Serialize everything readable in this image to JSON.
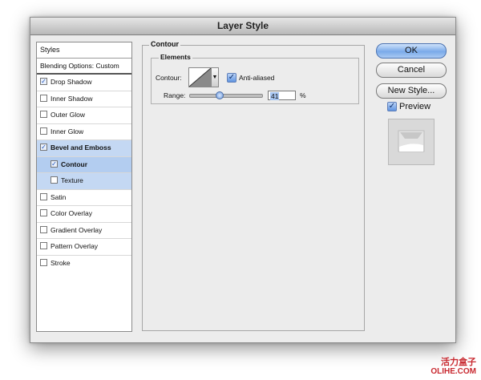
{
  "window": {
    "title": "Layer Style"
  },
  "styles_panel": {
    "header": "Styles",
    "blending_options": "Blending Options: Custom",
    "items": [
      {
        "label": "Drop Shadow",
        "checked": true,
        "bold": false,
        "indent": false
      },
      {
        "label": "Inner Shadow",
        "checked": false,
        "bold": false,
        "indent": false
      },
      {
        "label": "Outer Glow",
        "checked": false,
        "bold": false,
        "indent": false
      },
      {
        "label": "Inner Glow",
        "checked": false,
        "bold": false,
        "indent": false
      },
      {
        "label": "Bevel and Emboss",
        "checked": true,
        "bold": true,
        "indent": false
      },
      {
        "label": "Contour",
        "checked": true,
        "bold": true,
        "indent": true
      },
      {
        "label": "Texture",
        "checked": false,
        "bold": false,
        "indent": true
      },
      {
        "label": "Satin",
        "checked": false,
        "bold": false,
        "indent": false
      },
      {
        "label": "Color Overlay",
        "checked": false,
        "bold": false,
        "indent": false
      },
      {
        "label": "Gradient Overlay",
        "checked": false,
        "bold": false,
        "indent": false
      },
      {
        "label": "Pattern Overlay",
        "checked": false,
        "bold": false,
        "indent": false
      },
      {
        "label": "Stroke",
        "checked": false,
        "bold": false,
        "indent": false
      }
    ]
  },
  "contour_panel": {
    "title": "Contour",
    "elements_title": "Elements",
    "contour_label": "Contour:",
    "anti_aliased_label": "Anti-aliased",
    "anti_aliased_checked": true,
    "range_label": "Range:",
    "range_value": "41",
    "range_unit": "%"
  },
  "buttons": {
    "ok": "OK",
    "cancel": "Cancel",
    "new_style": "New Style..."
  },
  "preview": {
    "label": "Preview",
    "checked": true
  },
  "watermark": {
    "line1": "活力盒子",
    "line2": "OLIHE.COM"
  },
  "colors": {
    "selection": "#b3cdf0",
    "ok_button": "#7aaae9",
    "watermark": "#c8282f"
  }
}
